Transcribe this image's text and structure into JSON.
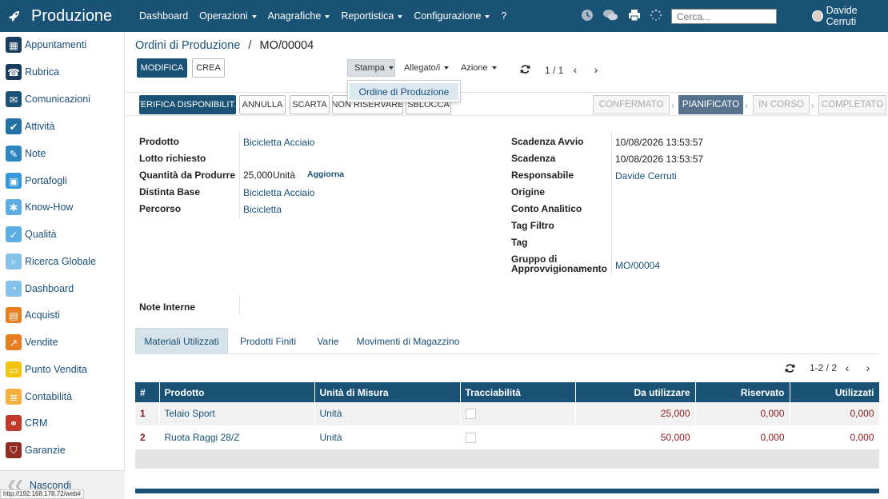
{
  "topbar": {
    "app_title": "Produzione",
    "menu": [
      {
        "label": "Dashboard",
        "has_caret": false
      },
      {
        "label": "Operazioni",
        "has_caret": true
      },
      {
        "label": "Anagrafiche",
        "has_caret": true
      },
      {
        "label": "Reportistica",
        "has_caret": true
      },
      {
        "label": "Configurazione",
        "has_caret": true
      },
      {
        "label": "?",
        "has_caret": false
      }
    ],
    "search_placeholder": "Cerca...",
    "user_name": "Davide Cerruti"
  },
  "sidebar": {
    "items": [
      {
        "label": "Appuntamenti",
        "color": "#1a3c5e"
      },
      {
        "label": "Rubrica",
        "color": "#1a3c5e"
      },
      {
        "label": "Comunicazioni",
        "color": "#1a5276"
      },
      {
        "label": "Attività",
        "color": "#2471a3"
      },
      {
        "label": "Note",
        "color": "#2e86c1"
      },
      {
        "label": "Portafogli",
        "color": "#3498db"
      },
      {
        "label": "Know-How",
        "color": "#5dade2"
      },
      {
        "label": "Qualità",
        "color": "#5dade2"
      },
      {
        "label": "Ricerca Globale",
        "color": "#85c1e9"
      },
      {
        "label": "Dashboard",
        "color": "#85c1e9"
      },
      {
        "label": "Acquisti",
        "color": "#e67e22"
      },
      {
        "label": "Vendite",
        "color": "#e67e22"
      },
      {
        "label": "Punto Vendita",
        "color": "#f1c40f"
      },
      {
        "label": "Contabilità",
        "color": "#f5b041"
      },
      {
        "label": "CRM",
        "color": "#c0392b"
      },
      {
        "label": "Garanzie",
        "color": "#922b21"
      }
    ],
    "hide_label": "Nascondi"
  },
  "status_url": "http://192.168.178.72/web#",
  "breadcrumb": {
    "parent": "Ordini di Produzione",
    "separator": "/",
    "current": "MO/00004"
  },
  "toolbar": {
    "edit_label": "MODIFICA",
    "create_label": "CREA",
    "print_label": "Stampa",
    "attachment_label": "Allegato/i",
    "action_label": "Azione",
    "pager": "1 / 1"
  },
  "print_menu": {
    "item": "Ordine di Produzione"
  },
  "status_bar": {
    "buttons": [
      "VERIFICA DISPONIBILITÀ",
      "ANNULLA",
      "SCARTA",
      "NON RISERVARE",
      "SBLOCCA"
    ],
    "stages": [
      {
        "label": "CONFERMATO",
        "active": false
      },
      {
        "label": "PIANIFICATO",
        "active": true
      },
      {
        "label": "IN CORSO",
        "active": false
      },
      {
        "label": "COMPLETATO",
        "active": false
      }
    ]
  },
  "form": {
    "left": {
      "product_label": "Prodotto",
      "product_value": "Bicicletta Acciaio",
      "lot_label": "Lotto richiesto",
      "lot_value": "",
      "qty_label": "Quantità da Produrre",
      "qty_value": "25,000",
      "qty_uom": "Unità",
      "qty_update": "Aggiorna",
      "bom_label": "Distinta Base",
      "bom_value": "Bicicletta Acciaio",
      "route_label": "Percorso",
      "route_value": "Bicicletta"
    },
    "right": {
      "start_label": "Scadenza Avvio",
      "start_value": "10/08/2026 13:53:57",
      "deadline_label": "Scadenza",
      "deadline_value": "10/08/2026 13:53:57",
      "responsible_label": "Responsabile",
      "responsible_value": "Davide Cerruti",
      "origin_label": "Origine",
      "origin_value": "",
      "analytic_label": "Conto Analitico",
      "analytic_value": "",
      "tagfilter_label": "Tag Filtro",
      "tagfilter_value": "",
      "tag_label": "Tag",
      "tag_value": "",
      "procurement_label_1": "Gruppo di",
      "procurement_label_2": "Approvvigionamento",
      "procurement_value": "MO/00004"
    },
    "notes_label": "Note Interne"
  },
  "tabs": [
    {
      "label": "Materiali Utilizzati",
      "active": true
    },
    {
      "label": "Prodotti Finiti",
      "active": false
    },
    {
      "label": "Varie",
      "active": false
    },
    {
      "label": "Movimenti di Magazzino",
      "active": false
    }
  ],
  "lines_pager": "1-2 / 2",
  "lines": {
    "headers": [
      "#",
      "Prodotto",
      "Unità di Misura",
      "Tracciabilità",
      "Da utilizzare",
      "Riservato",
      "Utilizzati"
    ],
    "rows": [
      {
        "idx": "1",
        "product": "Telaio Sport",
        "uom": "Unità",
        "to_use": "25,000",
        "reserved": "0,000",
        "used": "0,000"
      },
      {
        "idx": "2",
        "product": "Ruota Raggi 28/Z",
        "uom": "Unità",
        "to_use": "50,000",
        "reserved": "0,000",
        "used": "0,000"
      }
    ]
  },
  "colors": {
    "primary": "#1a5276",
    "stage_active": "#57728c",
    "quantity_red": "#8b1a1a"
  }
}
